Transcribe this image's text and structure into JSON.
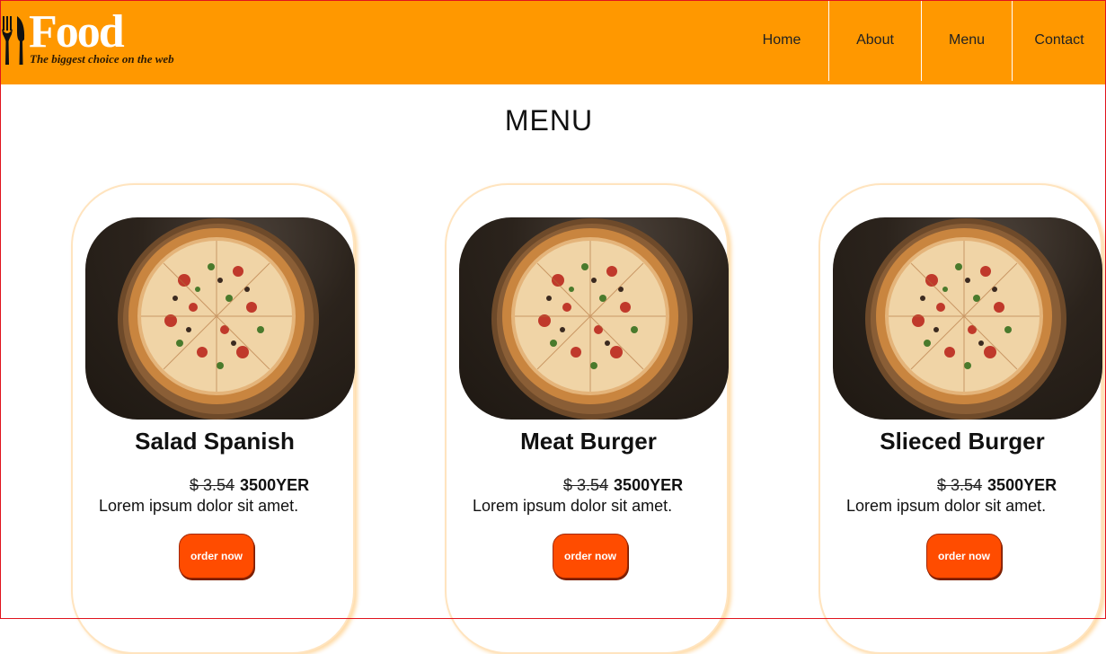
{
  "brand": {
    "name": "Food",
    "tagline": "The biggest choice on the web"
  },
  "nav": {
    "items": [
      {
        "label": "Home"
      },
      {
        "label": "About"
      },
      {
        "label": "Menu"
      },
      {
        "label": "Contact"
      }
    ]
  },
  "page": {
    "title": "MENU"
  },
  "cards": [
    {
      "name": "Salad Spanish",
      "old_price": "$ 3.54",
      "price": "3500YER",
      "description": "Lorem ipsum dolor sit amet.",
      "button": "order now"
    },
    {
      "name": "Meat Burger",
      "old_price": "$ 3.54",
      "price": "3500YER",
      "description": "Lorem ipsum dolor sit amet.",
      "button": "order now"
    },
    {
      "name": "Slieced Burger",
      "old_price": "$ 3.54",
      "price": "3500YER",
      "description": "Lorem ipsum dolor sit amet.",
      "button": "order now"
    }
  ],
  "colors": {
    "header": "#ff9800",
    "button": "#ff4c00",
    "card_border": "#ffe4bf"
  }
}
